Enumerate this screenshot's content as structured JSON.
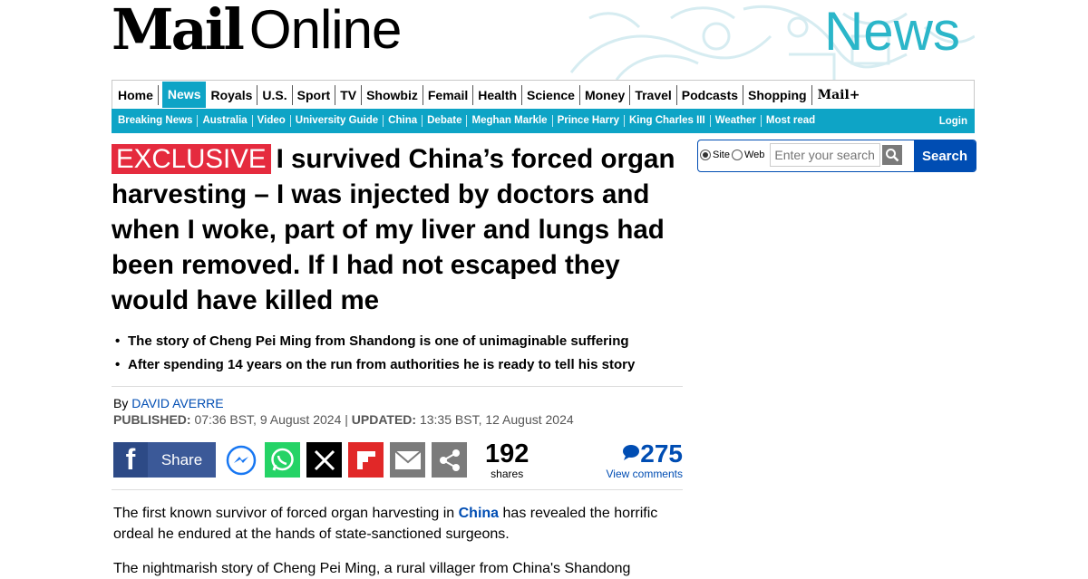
{
  "masthead": {
    "logo_mail": "Mail",
    "logo_online": "Online",
    "channel": "News",
    "brand_color": "#2bb6c9"
  },
  "nav_primary": {
    "items": [
      "Home",
      "News",
      "Royals",
      "U.S.",
      "Sport",
      "TV",
      "Showbiz",
      "Femail",
      "Health",
      "Science",
      "Money",
      "Travel",
      "Podcasts",
      "Shopping"
    ],
    "active": "News",
    "mail_plus": "Mail+"
  },
  "nav_secondary": {
    "items": [
      "Breaking News",
      "Australia",
      "Video",
      "University Guide",
      "China",
      "Debate",
      "Meghan Markle",
      "Prince Harry",
      "King Charles III",
      "Weather",
      "Most read"
    ],
    "login": "Login",
    "bg_color": "#0ea4c6"
  },
  "article": {
    "badge": "EXCLUSIVE",
    "headline": "I survived China’s forced organ harvesting – I was injected by doctors and when I woke, part of my liver and lungs had been removed. If I had not escaped they would have killed me",
    "bullets": [
      "The story of Cheng Pei Ming from Shandong is one of unimaginable suffering",
      "After spending 14 years on the run from authorities he is ready to tell his story"
    ],
    "byline_prefix": "By",
    "author": "DAVID AVERRE",
    "published_label": "PUBLISHED:",
    "published": "07:36 BST, 9 August 2024",
    "separator": "|",
    "updated_label": "UPDATED:",
    "updated": "13:35 BST, 12 August 2024",
    "body_p1_a": "The first known survivor of forced organ harvesting in ",
    "body_p1_link": "China",
    "body_p1_b": " has revealed the horrific ordeal he endured at the hands of state-sanctioned surgeons.",
    "body_p2": "The nightmarish story of Cheng Pei Ming, a rural villager from China's Shandong"
  },
  "share": {
    "facebook_label": "Share",
    "icons": [
      "messenger-icon",
      "whatsapp-icon",
      "x-icon",
      "flipboard-icon",
      "email-icon",
      "share-icon"
    ],
    "share_count": "192",
    "share_count_label": "shares",
    "comment_count": "275",
    "comment_label": "View comments"
  },
  "search": {
    "option_site": "Site",
    "option_web": "Web",
    "selected": "Site",
    "placeholder": "Enter your search",
    "button": "Search",
    "accent": "#004db3"
  }
}
